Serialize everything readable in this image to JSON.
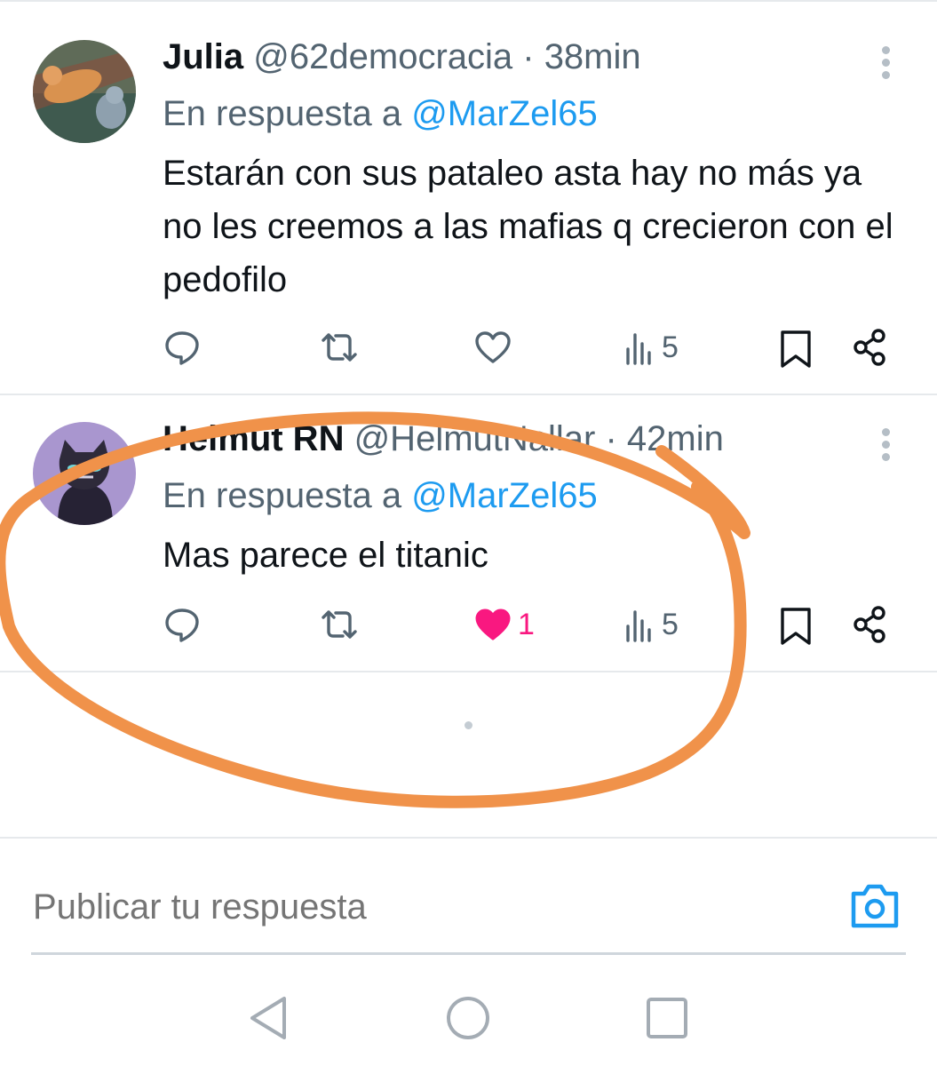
{
  "tweets": [
    {
      "name": "Julia",
      "handle": "@62democracia",
      "separator": " · ",
      "time": "38min",
      "reply_prefix": "En respuesta a ",
      "reply_to": "@MarZel65",
      "text": "Estarán con sus pataleo asta hay no más ya no les creemos a las mafias q crecieron con el pedofilo",
      "likes": "",
      "views": "5",
      "liked": false
    },
    {
      "name": "Helmut RN",
      "handle": "@HelmutNallar",
      "separator": " · ",
      "time": "42min",
      "reply_prefix": "En respuesta a ",
      "reply_to": "@MarZel65",
      "text": "Mas parece el titanic",
      "likes": "1",
      "views": "5",
      "liked": true
    }
  ],
  "compose": {
    "placeholder": "Publicar tu respuesta"
  },
  "icons": {
    "reply": "reply-icon",
    "retweet": "retweet-icon",
    "like": "heart-icon",
    "views": "views-icon",
    "bookmark": "bookmark-icon",
    "share": "share-icon",
    "more": "more-icon",
    "camera": "camera-icon",
    "nav_back": "back-triangle-icon",
    "nav_home": "home-circle-icon",
    "nav_recents": "recents-square-icon"
  },
  "colors": {
    "accent": "#1d9bf0",
    "like": "#f91880",
    "muted": "#536471",
    "annotation": "#f0924a"
  }
}
